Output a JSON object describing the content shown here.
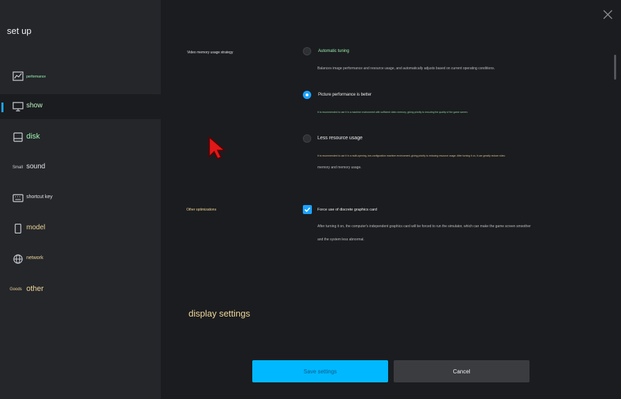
{
  "sidebar": {
    "title": "set up",
    "items": [
      {
        "label": "performance",
        "icon": "chart-line-icon",
        "icon_text": ""
      },
      {
        "label": "show",
        "icon": "monitor-icon",
        "icon_text": ""
      },
      {
        "label": "disk",
        "icon": "disk-icon",
        "icon_text": ""
      },
      {
        "label": "sound",
        "icon": "",
        "icon_text": "Small"
      },
      {
        "label": "shortcut key",
        "icon": "keyboard-icon",
        "icon_text": ""
      },
      {
        "label": "model",
        "icon": "phone-icon",
        "icon_text": ""
      },
      {
        "label": "network",
        "icon": "globe-icon",
        "icon_text": ""
      },
      {
        "label": "other",
        "icon": "",
        "icon_text": "Goods"
      }
    ],
    "active_index": 1
  },
  "settings": {
    "video_memory": {
      "label": "Video memory usage strategy",
      "options": [
        {
          "title": "Automatic tuning",
          "desc": "Balances image performance and resource usage, and automatically adjusts based on current operating conditions.",
          "desc2": "",
          "checked": false
        },
        {
          "title": "Picture performance is better",
          "desc": "It is recommended to use it in a machine environment with sufficient video memory, giving priority to ensuring the quality of the game screen.",
          "desc2": "",
          "checked": true
        },
        {
          "title": "Less resource usage",
          "desc": "It is recommended to use it in a multi-opening, low-configuration machine environment, giving priority to reducing resource usage. After turning it on, it can greatly reduce video",
          "desc2": "memory and memory usage.",
          "checked": false
        }
      ]
    },
    "other": {
      "label": "Other optimizations",
      "checkbox": {
        "title": "Force use of discrete graphics card",
        "desc": "After turning it on, the computer's independent graphics card will be forced to run the simulator, which can make the game screen smoother",
        "desc2": "and the system less abnormal.",
        "checked": true
      }
    },
    "display_settings_label": "display settings"
  },
  "buttons": {
    "save": "Save settings",
    "cancel": "Cancel"
  },
  "colors": {
    "accent": "#1aa3ff",
    "save_bg": "#00b8ff",
    "sidebar_bg": "#24262a",
    "main_bg": "#1b1c1f"
  }
}
